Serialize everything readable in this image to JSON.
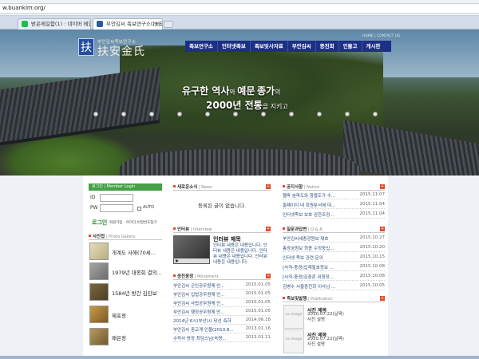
{
  "browser": {
    "address": "w.buankim.org/",
    "tabs": [
      {
        "label": "받은메일함(1) : 네이버 메일",
        "active": false,
        "favicon_color": "#19c14b"
      },
      {
        "label": "부안김씨 족보연구소(扶安...",
        "active": true,
        "favicon_color": "#2c5aa0"
      }
    ],
    "close_glyph": "×"
  },
  "header": {
    "logo_mark": "扶",
    "logo_sub": "부안김씨족보연구소",
    "logo_main": "扶安金氏",
    "util_links": "HOME  |  CONTACT US",
    "nav": [
      "족보연구소",
      "인터넷족보",
      "족보및사자료",
      "부안김씨",
      "종친회",
      "인물고",
      "게시판"
    ],
    "slogan_line1": [
      "유구한 역사",
      "와 ",
      "예문",
      "종가",
      "의"
    ],
    "slogan_line2": [
      "2000년 전통",
      "을 지키고"
    ],
    "slide_dots": 11
  },
  "login": {
    "head": "로그인 | Member Login",
    "id_label": "ID",
    "pw_label": "PW",
    "auto_label": "AUTO",
    "login_button": "로그인",
    "links": "회원가입 · 아이디,비밀번호찾기"
  },
  "gallery": {
    "title": "사진첩",
    "title_eng": "| Photo Gallery",
    "items": [
      {
        "caption": "개계도 사해(70세..."
      },
      {
        "caption": "1979년 대종회 결의..."
      },
      {
        "caption": "1584년 방간 김진보"
      },
      {
        "caption": "제포정"
      },
      {
        "caption": "매은정"
      }
    ],
    "thumb_colors": [
      "#cfc8a0",
      "#8c8c8c",
      "#6b5a3a",
      "#b08a40",
      "#a38a55"
    ]
  },
  "free_board": {
    "title": "새로운소식",
    "title_eng": "| News",
    "empty": "등록된 글이 없습니다."
  },
  "interview": {
    "title": "인터뷰",
    "title_eng": "| Interview",
    "headline": "인터뷰 제목",
    "body": "인터뷰 내용은 내용입니다. 인터뷰 내용은 내용입니다. 인터뷰 내용은 내용입니다. 인터뷰 내용은 내용입니다."
  },
  "movement": {
    "title": "종친동정",
    "title_eng": "| Movement",
    "rows": [
      {
        "title": "부안김씨 군인공무원께 안...",
        "date": "2015.01.05"
      },
      {
        "title": "부안김씨 입법공무원께 안...",
        "date": "2015.01.05"
      },
      {
        "title": "부안김씨 사법공무원께 안...",
        "date": "2015.01.05"
      },
      {
        "title": "부안김씨 행정공무원께 안...",
        "date": "2015.01.05"
      },
      {
        "title": "2014년 6시(부산)시 당선 축하",
        "date": "2014.06.18"
      },
      {
        "title": "부안김씨 중교계 인물(2013.8...",
        "date": "2013.01.16"
      },
      {
        "title": "수락사 방장 최담스님(속명...",
        "date": "2013.01.11"
      }
    ]
  },
  "notice": {
    "title": "공지사항",
    "title_eng": "| Notice",
    "rows": [
      {
        "title": "펠파 분파도와 항렬도가 수...",
        "date": "2015.11.07"
      },
      {
        "title": "홈페이지 내 회원분서에 대...",
        "date": "2015.11.04"
      },
      {
        "title": "인터넷족보 보호 권한조정...",
        "date": "2015.11.04"
      }
    ]
  },
  "qna": {
    "title": "질문과답변",
    "title_eng": "| Q & A",
    "rows": [
      {
        "title": "부안김씨세충광원보 제호",
        "date": "2015.10.27"
      },
      {
        "title": "총광궁원보 최종 수정중입...",
        "date": "2015.10.20"
      },
      {
        "title": "인터넷 족보 관련 문의",
        "date": "2015.10.15"
      },
      {
        "title": "[사직-충경]입재필호정보 ...",
        "date": "2015.10.08"
      },
      {
        "title": "[사직-충경]김중흔 위원장...",
        "date": "2015.10.08"
      },
      {
        "title": "김병수 서울종친회 이사님 ...",
        "date": "2015.10.05"
      }
    ]
  },
  "publication": {
    "title": "족보및발행",
    "title_eng": "| Publication",
    "no_image": "no image",
    "items": [
      {
        "title": "사진 제목",
        "date": "2010.07.22(날짜)",
        "desc": "사진 설명"
      },
      {
        "title": "사진 제목",
        "date": "2010.07.22(날짜)",
        "desc": "사진 설명"
      }
    ]
  },
  "colors": {
    "nav_bg": "#1e2f86",
    "login_green": "#45a047",
    "accent_red": "#e04d2c",
    "link_blue": "#2a4a7b"
  }
}
